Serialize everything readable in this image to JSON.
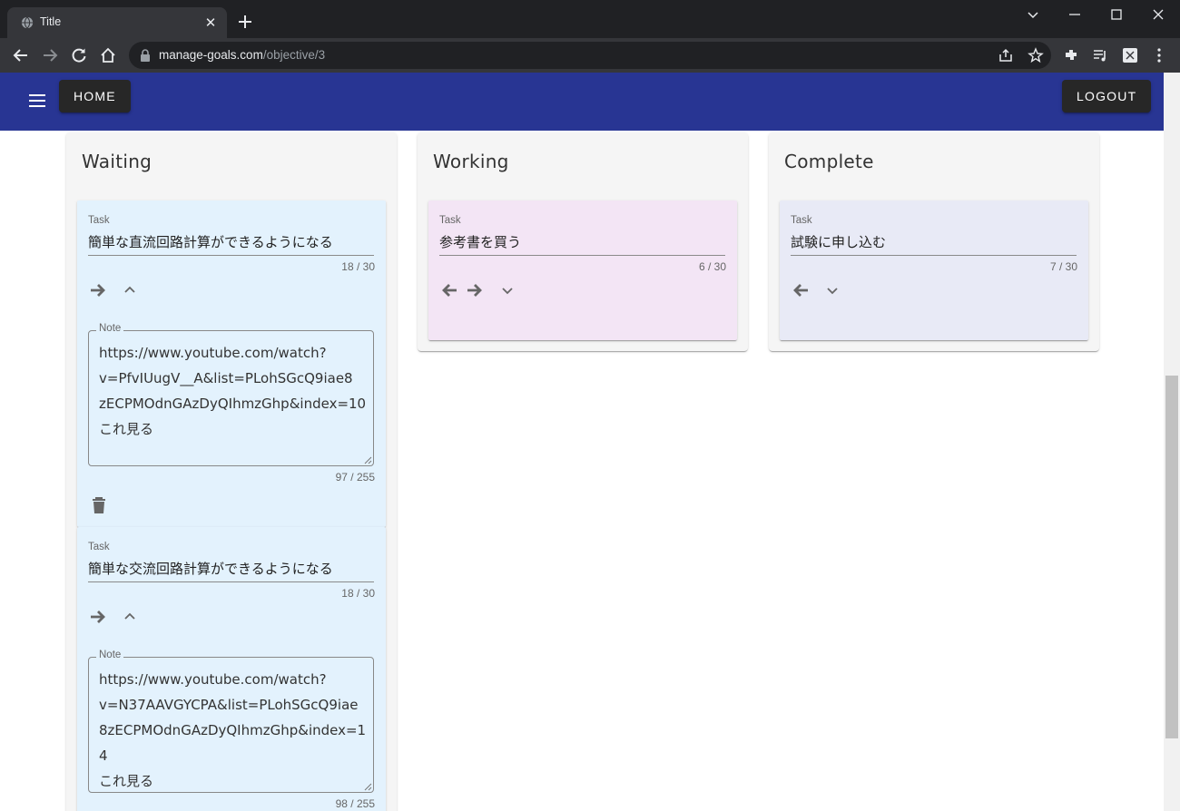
{
  "browser": {
    "tab_title": "Title",
    "url_domain": "manage-goals.com",
    "url_path": "/objective/3"
  },
  "appbar": {
    "home_label": "HOME",
    "logout_label": "LOGOUT",
    "color": "#283593"
  },
  "columns": [
    {
      "title": "Waiting",
      "color": "#e3f2fd",
      "cards": [
        {
          "task_label": "Task",
          "task": "簡単な直流回路計算ができるようになる",
          "task_count": "18 / 30",
          "note_label": "Note",
          "note_lines": [
            "https://www.youtube.com/watch?",
            "v=PfvIUugV__A&list=PLohSGcQ9iae8",
            "zECPMOdnGAzDyQIhmzGhp&index=10",
            "これ見る"
          ],
          "note_count": "97 / 255"
        },
        {
          "task_label": "Task",
          "task": "簡単な交流回路計算ができるようになる",
          "task_count": "18 / 30",
          "note_label": "Note",
          "note_lines": [
            "https://www.youtube.com/watch?",
            "v=N37AAVGYCPA&list=PLohSGcQ9iae",
            "8zECPMOdnGAzDyQIhmzGhp&index=1",
            "4",
            "これ見る"
          ],
          "note_count": "98 / 255"
        }
      ]
    },
    {
      "title": "Working",
      "color": "#f3e5f5",
      "cards": [
        {
          "task_label": "Task",
          "task": "参考書を買う",
          "task_count": "6 / 30"
        }
      ]
    },
    {
      "title": "Complete",
      "color": "#e8eaf6",
      "cards": [
        {
          "task_label": "Task",
          "task": "試験に申し込む",
          "task_count": "7 / 30"
        }
      ]
    }
  ]
}
